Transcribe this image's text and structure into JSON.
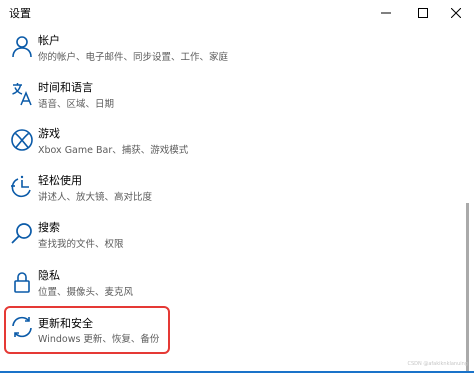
{
  "window": {
    "title": "设置"
  },
  "watermark": "CSDN @afakiknklanuing",
  "items": [
    {
      "label": "帐户",
      "desc": "你的帐户、电子邮件、同步设置、工作、家庭",
      "icon": "person-icon"
    },
    {
      "label": "时间和语言",
      "desc": "语音、区域、日期",
      "icon": "language-icon"
    },
    {
      "label": "游戏",
      "desc": "Xbox Game Bar、捕获、游戏模式",
      "icon": "xbox-icon"
    },
    {
      "label": "轻松使用",
      "desc": "讲述人、放大镜、高对比度",
      "icon": "ease-of-access-icon"
    },
    {
      "label": "搜索",
      "desc": "查找我的文件、权限",
      "icon": "search-icon"
    },
    {
      "label": "隐私",
      "desc": "位置、摄像头、麦克风",
      "icon": "lock-icon"
    },
    {
      "label": "更新和安全",
      "desc": "Windows 更新、恢复、备份",
      "icon": "sync-icon"
    }
  ],
  "colors": {
    "accent": "#0a5aa8",
    "highlight_border": "#e53935"
  }
}
